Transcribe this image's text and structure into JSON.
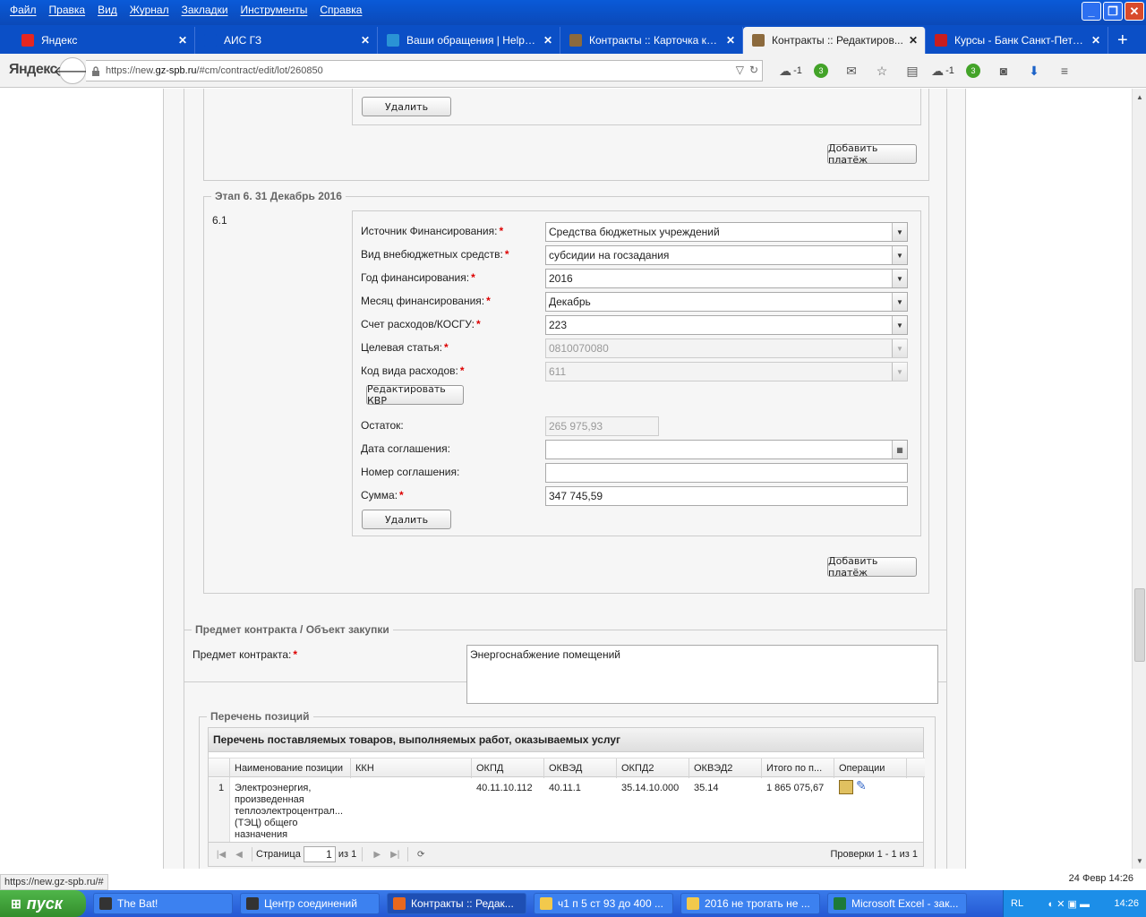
{
  "menu": [
    "Файл",
    "Правка",
    "Вид",
    "Журнал",
    "Закладки",
    "Инструменты",
    "Справка"
  ],
  "tabs": [
    {
      "label": "Яндекс",
      "icon": "yandex-icon",
      "color": "#e52620"
    },
    {
      "label": "АИС ГЗ",
      "icon": "blank-page-icon",
      "color": "#0b4fc6"
    },
    {
      "label": "Ваши обращения | HelpDes...",
      "icon": "help-icon",
      "color": "#2a93d5"
    },
    {
      "label": "Контракты :: Карточка ко...",
      "icon": "hammer-icon",
      "color": "#8c6a3d"
    },
    {
      "label": "Контракты :: Редактиров...",
      "icon": "hammer-icon",
      "color": "#8c6a3d",
      "active": true
    },
    {
      "label": "Курсы - Банк Санкт-Петер...",
      "icon": "bank-icon",
      "color": "#c81e1e"
    }
  ],
  "browser": {
    "logo": "Яндекс",
    "url_prefix": "https://new.",
    "url_host": "gz-spb.ru",
    "url_path": "/#cm/contract/edit/lot/260850",
    "cloud_count": "-1",
    "badge_count": "3"
  },
  "stage_prev": {
    "delete_label": "Удалить",
    "add_payment_label": "Добавить платёж"
  },
  "stage6": {
    "legend": "Этап 6. 31 Декабрь 2016",
    "number": "6.1",
    "fields": {
      "source_label": "Источник Финансирования:",
      "source_value": "Средства бюджетных учреждений",
      "kind_label": "Вид внебюджетных средств:",
      "kind_value": "субсидии на госзадания",
      "year_label": "Год финансирования:",
      "year_value": "2016",
      "month_label": "Месяц финансирования:",
      "month_value": "Декабрь",
      "account_label": "Счет расходов/КОСГУ:",
      "account_value": "223",
      "target_label": "Целевая статья:",
      "target_value": "0810070080",
      "expense_label": "Код вида расходов:",
      "expense_value": "611",
      "edit_kvr_label": "Редактировать КВР",
      "remainder_label": "Остаток:",
      "remainder_value": "265 975,93",
      "agreement_date_label": "Дата соглашения:",
      "agreement_date_value": "",
      "agreement_number_label": "Номер соглашения:",
      "agreement_number_value": "",
      "sum_label": "Сумма:",
      "sum_value": "347 745,59"
    },
    "delete_label": "Удалить",
    "add_payment_label": "Добавить платёж"
  },
  "subject": {
    "legend": "Предмет контракта / Объект закупки",
    "label": "Предмет контракта:",
    "value": "Энергоснабжение помещений"
  },
  "positions": {
    "legend": "Перечень позиций",
    "grid_title": "Перечень поставляемых товаров, выполняемых работ, оказываемых услуг",
    "columns": [
      "Наименование позиции",
      "ККН",
      "ОКПД",
      "ОКВЭД",
      "ОКПД2",
      "ОКВЭД2",
      "Итого по п...",
      "Операции"
    ],
    "rows": [
      {
        "num": "1",
        "name": [
          "Электроэнергия,",
          "произведенная",
          "теплоэлектроцентрал...",
          "(ТЭЦ) общего",
          "назначения"
        ],
        "kkn": "",
        "okpd": "40.11.10.112",
        "okved": "40.11.1",
        "okpd2": "35.14.10.000",
        "okved2": "35.14",
        "total": "1 865 075,67"
      }
    ],
    "pager": {
      "page_label": "Страница",
      "page_value": "1",
      "of_label": "из 1",
      "summary": "Проверки 1 - 1 из 1"
    }
  },
  "status_url": "https://new.gz-spb.ru/#",
  "status_date": "24 Февр 14:26",
  "taskbar": {
    "start_label": "пуск",
    "tasks": [
      {
        "label": "The Bat!",
        "icon": "bat-icon",
        "color": "#333333"
      },
      {
        "label": "Центр соединений",
        "icon": "bat-icon",
        "color": "#333333"
      },
      {
        "label": "Контракты :: Редак...",
        "icon": "firefox-icon",
        "color": "#e8681d",
        "active": true
      },
      {
        "label": "ч1 п 5 ст 93 до 400 ...",
        "icon": "folder-icon",
        "color": "#f2c94c"
      },
      {
        "label": "2016 не трогать не ...",
        "icon": "folder-icon",
        "color": "#f2c94c"
      },
      {
        "label": "Microsoft Excel - зак...",
        "icon": "excel-icon",
        "color": "#1d7a3a"
      }
    ],
    "tray_lang": "RL",
    "tray_time": "14:26"
  }
}
